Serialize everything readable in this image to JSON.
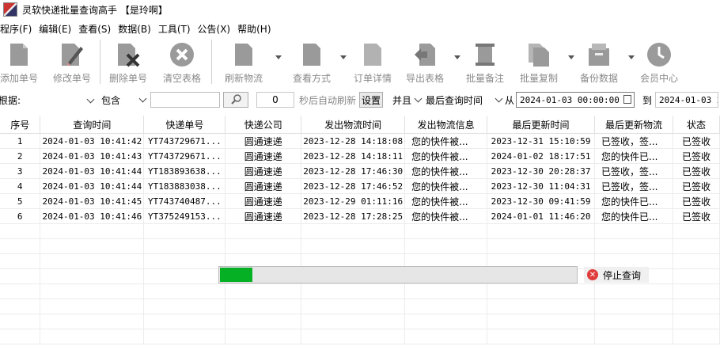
{
  "window": {
    "title": "灵软快递批量查询高手 【是玲啊】"
  },
  "menu": [
    "程序(F)",
    "编辑(E)",
    "查看(S)",
    "数据(B)",
    "工具(T)",
    "公告(X)",
    "帮助(H)"
  ],
  "toolbar": {
    "add": "添加单号",
    "edit": "修改单号",
    "delete": "删除单号",
    "clear": "清空表格",
    "refresh": "刷新物流",
    "view_mode": "查看方式",
    "order_detail": "订单详情",
    "export": "导出表格",
    "batch_note": "批量备注",
    "batch_copy": "批量复制",
    "backup": "备份数据",
    "member": "会员中心"
  },
  "filter": {
    "label": "根据:",
    "field_value": "",
    "match_value": "包含",
    "keyword_value": "",
    "auto_refresh_value": "0",
    "auto_refresh_label": "秒后自动刷新",
    "settings_button": "设置",
    "logic_value": "并且",
    "date_field_value": "最后查询时间",
    "from_label": "从",
    "from_value": "2024-01-03 00:00:00",
    "to_label": "到",
    "to_value": "2024-01-03 2"
  },
  "table": {
    "columns": [
      "序号",
      "查询时间",
      "快递单号",
      "快递公司",
      "发出物流时间",
      "发出物流信息",
      "最后更新时间",
      "最后更新物流",
      "状态"
    ],
    "rows": [
      [
        "1",
        "2024-01-03 10:41:42",
        "YT743729671...",
        "圆通速递",
        "2023-12-28 14:18:08",
        "您的快件被...",
        "2023-12-31 15:10:59",
        "已签收，签...",
        "已签收"
      ],
      [
        "2",
        "2024-01-03 10:41:43",
        "YT743729671...",
        "圆通速递",
        "2023-12-28 14:18:11",
        "您的快件被...",
        "2024-01-02 18:17:51",
        "您的快件已...",
        "已签收"
      ],
      [
        "3",
        "2024-01-03 10:41:44",
        "YT183893638...",
        "圆通速递",
        "2023-12-28 17:46:30",
        "您的快件被...",
        "2023-12-30 20:28:37",
        "已签收，签...",
        "已签收"
      ],
      [
        "4",
        "2024-01-03 10:41:44",
        "YT183883038...",
        "圆通速递",
        "2023-12-28 17:46:52",
        "您的快件被...",
        "2023-12-30 11:04:31",
        "已签收，签...",
        "已签收"
      ],
      [
        "5",
        "2024-01-03 10:41:45",
        "YT743740487...",
        "圆通速递",
        "2023-12-29 01:11:16",
        "您的快件被...",
        "2023-12-30 09:41:59",
        "您的快件已...",
        "已签收"
      ],
      [
        "6",
        "2024-01-03 10:41:46",
        "YT375249153...",
        "圆通速递",
        "2023-12-28 17:28:25",
        "您的快件被...",
        "2024-01-01 11:46:20",
        "您的快件已...",
        "已签收"
      ]
    ]
  },
  "progress": {
    "fraction": 0.09,
    "stop_label": "停止查询"
  },
  "colors": {
    "progress": "#06b025",
    "stop": "#e03c3c"
  }
}
